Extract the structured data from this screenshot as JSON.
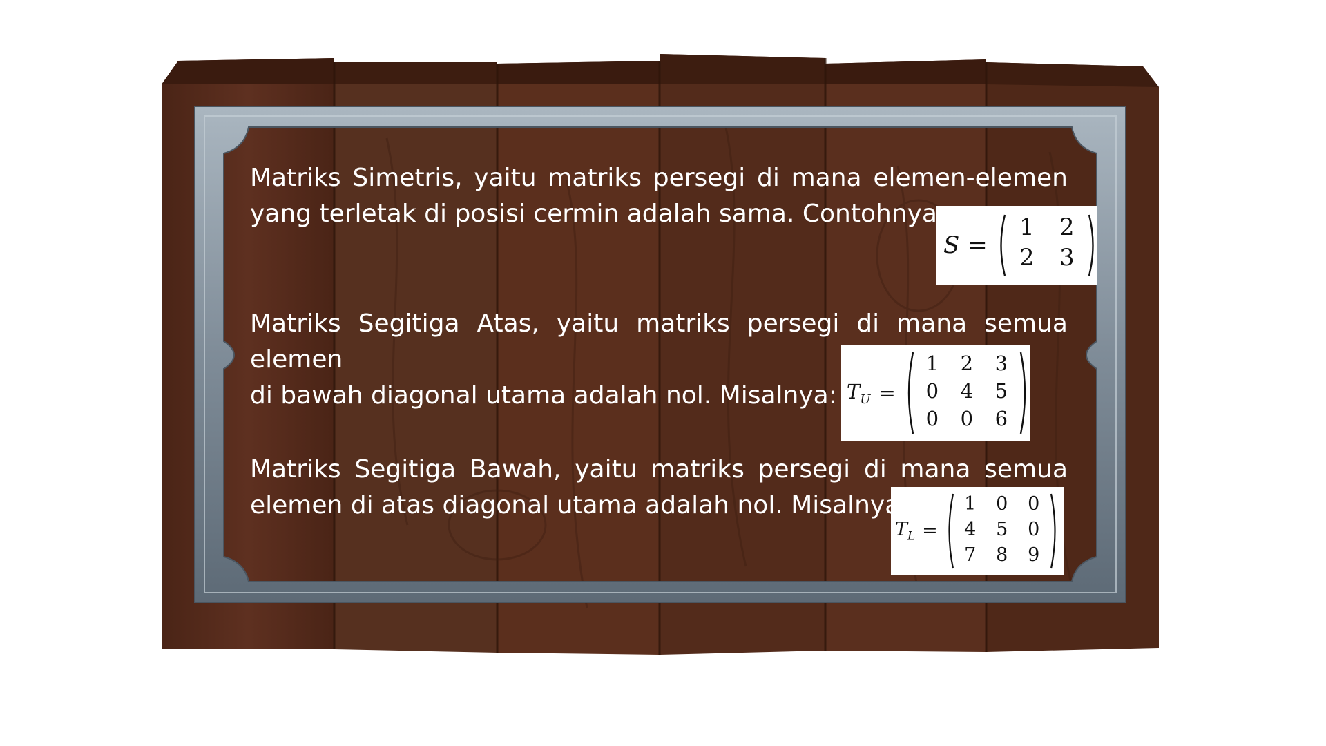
{
  "colors": {
    "page_background": "#ffffff",
    "wood": "#5a2e1c",
    "wood_dark": "#3d1e12",
    "frame_metal": "#8a97a3",
    "text": "#ffffff",
    "matrix_background": "#ffffff",
    "matrix_text": "#111111"
  },
  "sections": [
    {
      "lines": [
        "Matriks Simetris, yaitu matriks persegi di mana elemen-elemen",
        "yang terletak di posisi cermin adalah sama. Contohnya:"
      ],
      "matrix": {
        "label": "S",
        "subscript": "",
        "equals": "=",
        "rows": [
          [
            "1",
            "2"
          ],
          [
            "2",
            "3"
          ]
        ]
      }
    },
    {
      "lines": [
        "Matriks Segitiga Atas, yaitu matriks persegi di mana semua elemen",
        "di bawah diagonal utama adalah nol. Misalnya:"
      ],
      "matrix": {
        "label": "T",
        "subscript": "U",
        "equals": "=",
        "rows": [
          [
            "1",
            "2",
            "3"
          ],
          [
            "0",
            "4",
            "5"
          ],
          [
            "0",
            "0",
            "6"
          ]
        ]
      }
    },
    {
      "lines": [
        "Matriks Segitiga Bawah, yaitu matriks persegi di mana semua",
        "elemen di atas diagonal utama adalah nol. Misalnya:"
      ],
      "matrix": {
        "label": "T",
        "subscript": "L",
        "equals": "=",
        "rows": [
          [
            "1",
            "0",
            "0"
          ],
          [
            "4",
            "5",
            "0"
          ],
          [
            "7",
            "8",
            "9"
          ]
        ]
      }
    }
  ]
}
